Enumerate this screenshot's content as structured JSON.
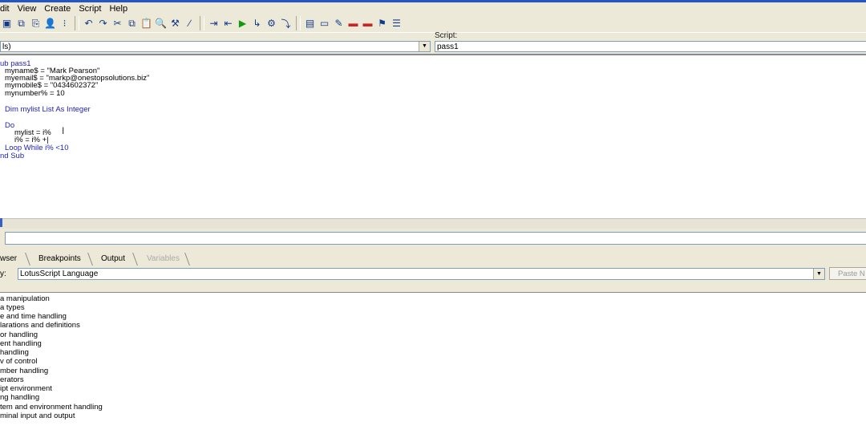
{
  "menu": [
    "dit",
    "View",
    "Create",
    "Script",
    "Help"
  ],
  "toolbar_icons": [
    "new-doc-icon",
    "copy-doc-icon",
    "paste-doc-icon",
    "user-icon",
    "tools-icon",
    "undo-icon",
    "redo-icon",
    "cut-icon",
    "copy-icon",
    "paste-icon",
    "find-icon",
    "hammer-icon",
    "wand-icon",
    "indent-icon",
    "outdent-icon",
    "run-icon",
    "step-icon",
    "debug-icon",
    "step-into-icon",
    "properties-icon",
    "window-icon",
    "edit-icon",
    "field-icon",
    "field2-icon",
    "agent-icon",
    "list-icon"
  ],
  "script_label": "Script:",
  "object_combo": "ls)",
  "script_combo": "pass1",
  "code": [
    {
      "text": "ub pass1",
      "kw": false,
      "indent": 0
    },
    {
      "text": "myname$ = \"Mark Pearson\"",
      "kw": false,
      "indent": 6
    },
    {
      "text": "myemail$ = \"markp@onestopsolutions.biz\"",
      "kw": false,
      "indent": 6
    },
    {
      "text": "mymobile$ = \"0434602372\"",
      "kw": false,
      "indent": 6
    },
    {
      "text": "mynumber% = 10",
      "kw": false,
      "indent": 6
    },
    {
      "text": "",
      "kw": false,
      "indent": 0
    },
    {
      "text": "Dim mylist List As Integer",
      "kw": true,
      "indent": 6
    },
    {
      "text": "",
      "kw": false,
      "indent": 0
    },
    {
      "text": "Do",
      "kw": true,
      "indent": 6
    },
    {
      "text": "mylist = i%",
      "kw": false,
      "indent": 18
    },
    {
      "text": "i% = i% +|",
      "kw": false,
      "indent": 18
    },
    {
      "text": "Loop While i% <10",
      "kw": true,
      "indent": 6
    },
    {
      "text": "nd Sub",
      "kw": true,
      "indent": 0
    }
  ],
  "tabs": {
    "browser": "wser",
    "breakpoints": "Breakpoints",
    "output": "Output",
    "variables": "Variables"
  },
  "category_label": "y:",
  "category_value": "LotusScript Language",
  "paste_button": "Paste N",
  "browser_items": [
    "a manipulation",
    "a types",
    "e and time handling",
    "larations and definitions",
    "or handling",
    "ent handling",
    "handling",
    "v of control",
    "mber handling",
    "erators",
    "ipt environment",
    "ng handling",
    "tem and environment handling",
    "minal input and output"
  ]
}
